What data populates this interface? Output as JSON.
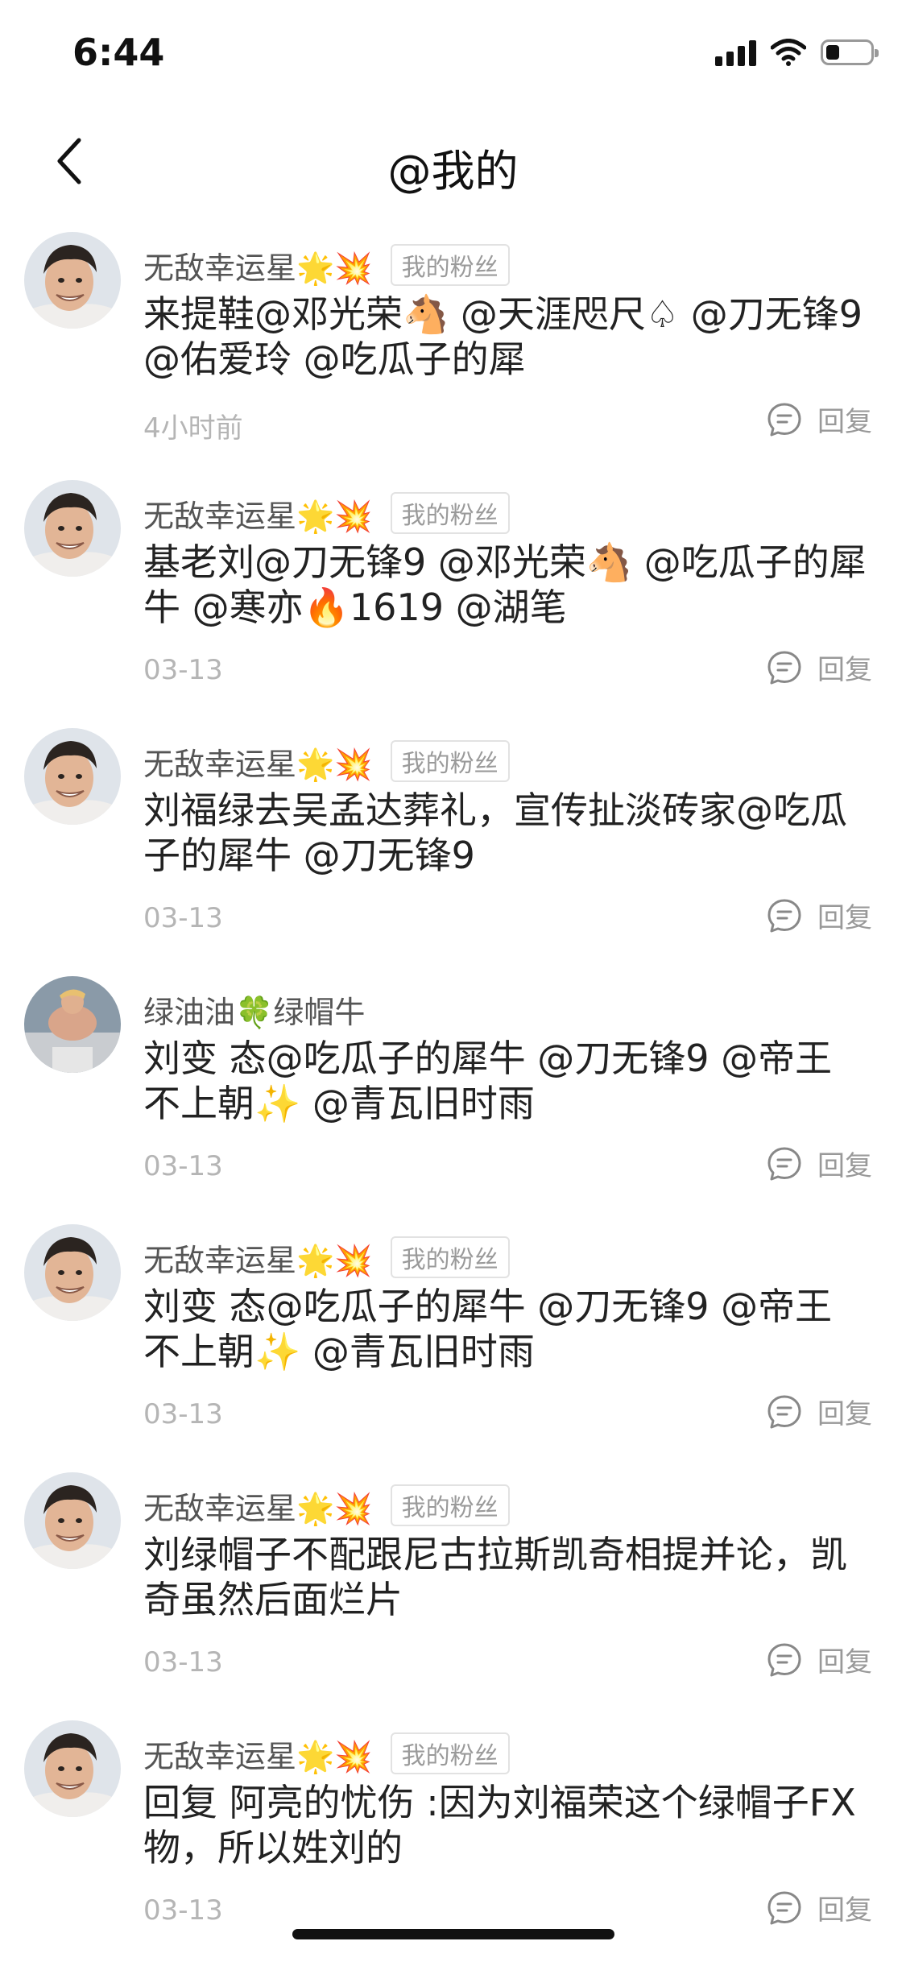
{
  "status_bar": {
    "time": "6:44",
    "battery_level": 0.3
  },
  "header": {
    "title": "@我的"
  },
  "badge_label": "我的粉丝",
  "reply_label": "回复",
  "comments": [
    {
      "username": "无敌幸运星🌟💥",
      "avatar": "man-portrait",
      "fan_badge": true,
      "text": "来提鞋@邓光荣🐴 @天涯咫尺♤ @刀无锋9 @佑爱玲 @吃瓜子的犀",
      "time": "4小时前"
    },
    {
      "username": "无敌幸运星🌟💥",
      "avatar": "man-portrait",
      "fan_badge": true,
      "text": "基老刘@刀无锋9 @邓光荣🐴 @吃瓜子的犀牛 @寒亦🔥1619 @湖笔",
      "time": "03-13"
    },
    {
      "username": "无敌幸运星🌟💥",
      "avatar": "man-portrait",
      "fan_badge": true,
      "text": "刘福绿去吴孟达葬礼，宣传扯淡砖家@吃瓜子的犀牛 @刀无锋9",
      "time": "03-13"
    },
    {
      "username": "绿油油🍀绿帽牛",
      "avatar": "statue-figure",
      "fan_badge": false,
      "text": "刘变 态@吃瓜子的犀牛 @刀无锋9 @帝王不上朝✨ @青瓦旧时雨",
      "time": "03-13"
    },
    {
      "username": "无敌幸运星🌟💥",
      "avatar": "man-portrait",
      "fan_badge": true,
      "text": "刘变 态@吃瓜子的犀牛 @刀无锋9 @帝王不上朝✨ @青瓦旧时雨",
      "time": "03-13"
    },
    {
      "username": "无敌幸运星🌟💥",
      "avatar": "man-portrait",
      "fan_badge": true,
      "text": "刘绿帽子不配跟尼古拉斯凯奇相提并论，凯奇虽然后面烂片",
      "time": "03-13"
    },
    {
      "username": "无敌幸运星🌟💥",
      "avatar": "man-portrait",
      "fan_badge": true,
      "text": "回复 阿亮的忧伤 :因为刘福荣这个绿帽子FX物，所以姓刘的",
      "time": "03-13"
    }
  ]
}
